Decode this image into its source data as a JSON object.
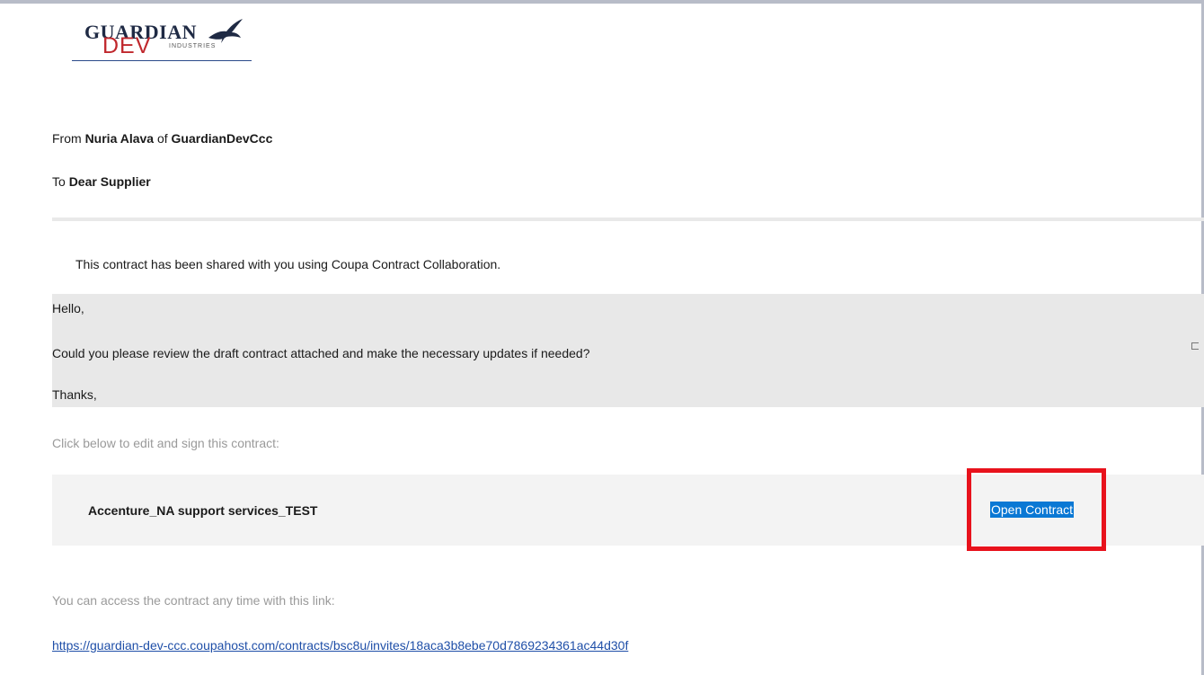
{
  "logo": {
    "brand": "GUARDIAN",
    "sub": "DEV",
    "tagline": "INDUSTRIES"
  },
  "header": {
    "from_prefix": "From",
    "sender_name": "Nuria Alava",
    "from_of": "of",
    "sender_org": "GuardianDevCcc",
    "to_prefix": "To",
    "recipient": "Dear Supplier"
  },
  "intro": "This contract has been shared with you using Coupa Contract Collaboration.",
  "message": {
    "greeting": "Hello,",
    "body": "Could you please review the draft contract attached and make the necessary updates if needed?",
    "closing": "Thanks,"
  },
  "instructions": "Click below to edit and sign this contract:",
  "contract": {
    "name": "Accenture_NA support services_TEST",
    "action_label": "Open Contract"
  },
  "access": {
    "text": "You can access the contract any time with this link:",
    "url": "https://guardian-dev-ccc.coupahost.com/contracts/bsc8u/invites/18aca3b8ebe70d7869234361ac44d30f"
  },
  "colors": {
    "highlight": "#e8121c",
    "link": "#1f4fa8",
    "button_bg": "#0a78d4",
    "brand_red": "#c0282d"
  }
}
